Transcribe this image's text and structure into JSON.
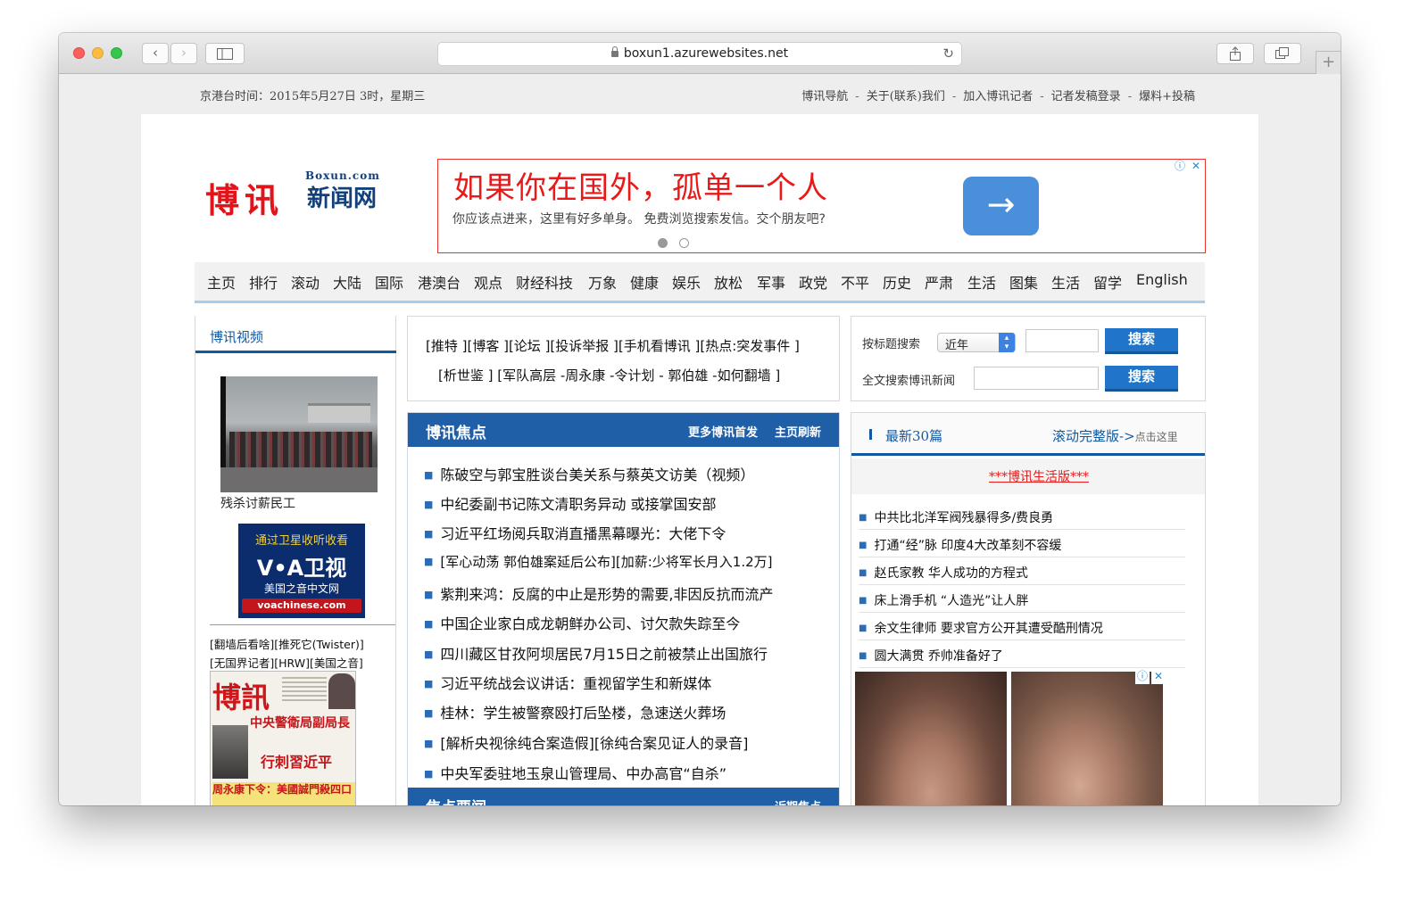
{
  "browser": {
    "url": "boxun1.azurewebsites.net"
  },
  "top_bar": {
    "datetime": "京港台时间：2015年5月27日 3时，星期三",
    "links": [
      "博讯导航",
      "关于(联系)我们",
      "加入博讯记者",
      "记者发稿登录",
      "爆料+投稿"
    ],
    "separator": "-"
  },
  "logo": {
    "main": "博讯",
    "sub": "新闻网",
    "tag": "Boxun.com"
  },
  "ad": {
    "headline": "如果你在国外，孤单一个人",
    "subtext": "你应该点进来，这里有好多单身。 免费浏览搜索发信。交个朋友吧?",
    "arrow": "→",
    "info_icon": "ⓘ",
    "close_icon": "✕"
  },
  "nav": [
    "主页",
    "排行",
    "滚动",
    "大陆",
    "国际",
    "港澳台",
    "观点",
    "财经科技",
    "万象",
    "健康",
    "娱乐",
    "放松",
    "军事",
    "政党",
    "不平",
    "历史",
    "严肃",
    "生活",
    "图集",
    "生活",
    "留学",
    "English"
  ],
  "left": {
    "video_title": "博讯视频",
    "video_caption": "残杀讨薪民工",
    "voa": {
      "line1": "通过卫星收听收看",
      "logo": "V•A卫视",
      "line2": "美国之音中文网",
      "url": "voachinese.com"
    },
    "links_line1": "[翻墙后看啥][推死它(Twister)]",
    "links_line2": "[无国界记者][HRW][美国之音]",
    "paper": {
      "masthead": "博訊",
      "headline1": "中央警衛局副局長",
      "headline2": "行刺習近平",
      "headline3": "周永康下令：美國誠門殺四口"
    }
  },
  "middle": {
    "links_line1": "[推特 ][博客 ][论坛 ][投诉举报 ][手机看博讯 ][热点:突发事件 ]",
    "links_line2": "[析世鉴 ] [军队高层 -周永康 -令计划 - 郭伯雄 -如何翻墙 ]",
    "focus_title": "博讯焦点",
    "focus_more": "更多博讯首发",
    "focus_refresh": "主页刷新",
    "focus_items": [
      "陈破空与郭宝胜谈台美关系与蔡英文访美（视频）",
      "中纪委副书记陈文清职务异动 或接掌国安部",
      "习近平红场阅兵取消直播黑幕曝光：大佬下令",
      "[军心动荡 郭伯雄案延后公布][加薪:少将军长月入1.2万]",
      "紫荆来鸿：反腐的中止是形势的需要,非因反抗而流产",
      "中国企业家白成龙朝鲜办公司、讨欠款失踪至今",
      "四川藏区甘孜阿坝居民7月15日之前被禁止出国旅行",
      "习近平统战会议讲话：重视留学生和新媒体",
      "桂林：学生被警察殴打后坠楼，急速送火葬场",
      "[解析央视徐纯合案造假][徐纯合案见证人的录音]",
      "中央军委驻地玉泉山管理局、中办高官“自杀”"
    ],
    "news_title": "焦点要闻",
    "news_more": "近期焦点"
  },
  "right": {
    "search_title_label": "按标题搜索",
    "search_select": "近年",
    "search_full_label": "全文搜索博讯新闻",
    "search_btn": "搜索",
    "latest_title": "最新30篇",
    "scroll_link": "滚动完整版->",
    "scroll_hint": "点击这里",
    "life_link": "***博讯生活版***",
    "items": [
      "中共比北洋军阀残暴得多/费良勇",
      "打通“经”脉 印度4大改革刻不容缓",
      "赵氏家教 华人成功的方程式",
      "床上滑手机 “人造光”让人胖",
      "余文生律师 要求官方公开其遭受酷刑情况",
      "圆大满贯 乔帅准备好了"
    ]
  },
  "colors": {
    "brand_blue": "#1f5fa8",
    "ad_red": "#e81919",
    "logo_red": "#e0141a"
  }
}
